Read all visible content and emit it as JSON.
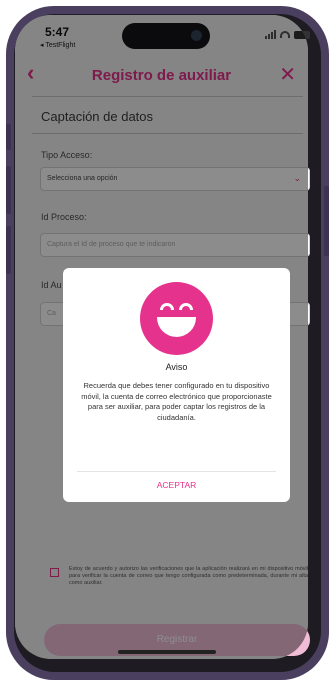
{
  "status": {
    "time": "5:47",
    "back_app": "◂ TestFlight"
  },
  "navbar": {
    "back_glyph": "‹",
    "title": "Registro de auxiliar",
    "close_glyph": "✕"
  },
  "form": {
    "section_title": "Captación de datos",
    "tipo_label": "Tipo Acceso:",
    "tipo_value": "Selecciona una opción",
    "proceso_label": "Id Proceso:",
    "proceso_placeholder": "Captura el Id de proceso que te indicaron",
    "auxiliar_label": "Id Au",
    "auxiliar_placeholder": "Ca"
  },
  "consent": {
    "text": "Estoy de acuerdo y autorizo las verificaciones que la aplicación realizará en mi dispositivo móvil para verificar la cuenta de correo que tengo configurada como predeterminada, durante mi alta como auxiliar."
  },
  "submit": {
    "label": "Registrar"
  },
  "dialog": {
    "title": "Aviso",
    "body": "Recuerda que debes tener configurado en tu dispositivo móvil, la cuenta de correo electrónico que proporcionaste para ser auxiliar, para poder captar los registros  de la ciudadanía.",
    "button": "ACEPTAR"
  },
  "colors": {
    "accent": "#e6308a",
    "frame": "#4a3f5e",
    "overlay": "rgba(0,0,0,0.45)"
  }
}
